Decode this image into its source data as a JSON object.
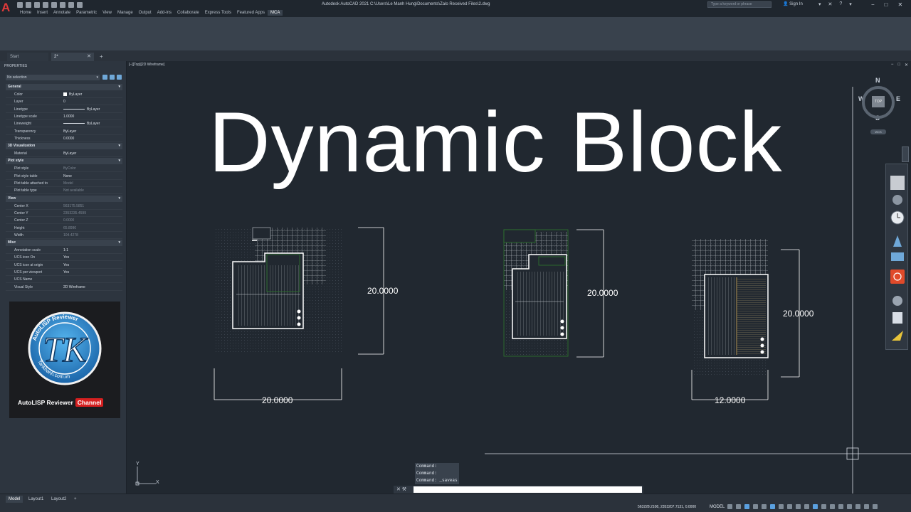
{
  "window": {
    "title": "Autodesk AutoCAD 2021    C:\\Users\\Le Manh Hung\\Documents\\Zalo Received Files\\2.dwg",
    "logo": "A",
    "search_placeholder": "Type a keyword or phrase",
    "sign_in": "Sign In",
    "controls": [
      "−",
      "□",
      "✕"
    ],
    "extra_icons": [
      "▾",
      "✕",
      "?",
      "▾"
    ]
  },
  "ribbon": {
    "tabs": [
      "Home",
      "Insert",
      "Annotate",
      "Parametric",
      "View",
      "Manage",
      "Output",
      "Add-ins",
      "Collaborate",
      "Express Tools",
      "Featured Apps",
      "MCA"
    ],
    "active_tab": "MCA"
  },
  "doc_tabs": {
    "start": "Start",
    "active": "2*",
    "close": "✕",
    "add": "+"
  },
  "properties": {
    "title": "PROPERTIES",
    "selection": "No selection",
    "sections": [
      {
        "name": "General",
        "rows": [
          {
            "key": "Color",
            "value": "ByLayer"
          },
          {
            "key": "Layer",
            "value": "0"
          },
          {
            "key": "Linetype",
            "value": "ByLayer"
          },
          {
            "key": "Linetype scale",
            "value": "1.0000"
          },
          {
            "key": "Lineweight",
            "value": "ByLayer"
          },
          {
            "key": "Transparency",
            "value": "ByLayer"
          },
          {
            "key": "Thickness",
            "value": "0.0000"
          }
        ]
      },
      {
        "name": "3D Visualization",
        "rows": [
          {
            "key": "Material",
            "value": "ByLayer"
          }
        ]
      },
      {
        "name": "Plot style",
        "rows": [
          {
            "key": "Plot style",
            "value": "ByColor",
            "dim": true
          },
          {
            "key": "Plot style table",
            "value": "None"
          },
          {
            "key": "Plot table attached to",
            "value": "Model",
            "dim": true
          },
          {
            "key": "Plot table type",
            "value": "Not available",
            "dim": true
          }
        ]
      },
      {
        "name": "View",
        "rows": [
          {
            "key": "Center X",
            "value": "563175.5851",
            "dim": true
          },
          {
            "key": "Center Y",
            "value": "2353235.4599",
            "dim": true
          },
          {
            "key": "Center Z",
            "value": "0.0000",
            "dim": true
          },
          {
            "key": "Height",
            "value": "65.8996",
            "dim": true
          },
          {
            "key": "Width",
            "value": "104.4278",
            "dim": true
          }
        ]
      },
      {
        "name": "Misc",
        "rows": [
          {
            "key": "Annotation scale",
            "value": "1:1"
          },
          {
            "key": "UCS icon On",
            "value": "Yes"
          },
          {
            "key": "UCS icon at origin",
            "value": "Yes"
          },
          {
            "key": "UCS per viewport",
            "value": "Yes"
          },
          {
            "key": "UCS Name",
            "value": ""
          },
          {
            "key": "Visual Style",
            "value": "2D Wireframe"
          }
        ]
      }
    ]
  },
  "logo_card": {
    "monogram": "TK",
    "ring_text": "AutoLISP Reviewer",
    "ring_text_bottom": "Tankhanh.com.vn",
    "caption": "AutoLISP Reviewer",
    "channel": "Channel"
  },
  "drawing": {
    "viewport_label": "[−][Top][2D Wireframe]",
    "viewport_controls": [
      "−",
      "□",
      "✕"
    ],
    "headline": "Dynamic Block",
    "dimensions": {
      "plan1_height": "20.0000",
      "plan1_width": "20.0000",
      "plan2_height": "20.0000",
      "plan3_height": "20.0000",
      "plan3_width": "12.0000"
    },
    "ucs_x": "X",
    "ucs_y": "Y"
  },
  "viewcube": {
    "north": "N",
    "south": "S",
    "east": "E",
    "west": "W",
    "face": "TOP",
    "wcs": "WCS"
  },
  "command": {
    "history": [
      "Command:",
      "Command:",
      "Command: _saveas"
    ],
    "icons": "✕ 🔧"
  },
  "status": {
    "tabs": [
      "Model",
      "Layout1",
      "Layout2",
      "+"
    ],
    "coords": "563228.2108, 2353207.7131, 0.0000",
    "mode": "MODEL"
  },
  "colors": {
    "background": "#212830",
    "accent_blue": "#5aa0e0",
    "logo_red": "#e03a3a",
    "plan_green": "#2e7a2e"
  }
}
